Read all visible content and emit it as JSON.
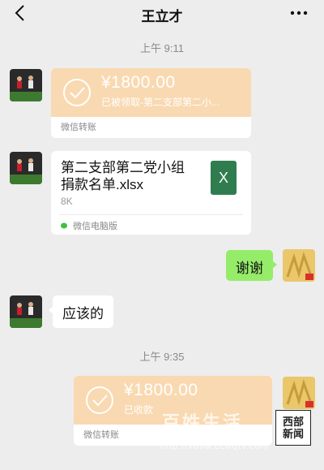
{
  "header": {
    "title": "王立才",
    "back_icon": "chevron-left-icon",
    "more_icon": "more-dots-icon"
  },
  "messages": {
    "time1": "上午 9:11",
    "transfer1": {
      "amount": "¥1800.00",
      "status": "已被领取-第二支部第二小...",
      "label": "微信转账"
    },
    "file": {
      "name_line1": "第二支部第二党小组",
      "name_line2": "捐款名单.xlsx",
      "size": "8K",
      "icon_letter": "X",
      "source": "微信电脑版"
    },
    "reply": "谢谢",
    "response": "应该的",
    "time2": "上午 9:35",
    "transfer2": {
      "amount": "¥1800.00",
      "status": "已收款",
      "label": "微信转账"
    }
  },
  "watermark": {
    "text": "百姓生活",
    "url": "http://xbsw.ccwqtv.com",
    "box_line1": "西部",
    "box_line2": "新闻"
  },
  "colors": {
    "background": "#ededed",
    "transfer": "#f9d9b1",
    "green_bubble": "#95ec69",
    "xlsx": "#2f7d4f"
  }
}
